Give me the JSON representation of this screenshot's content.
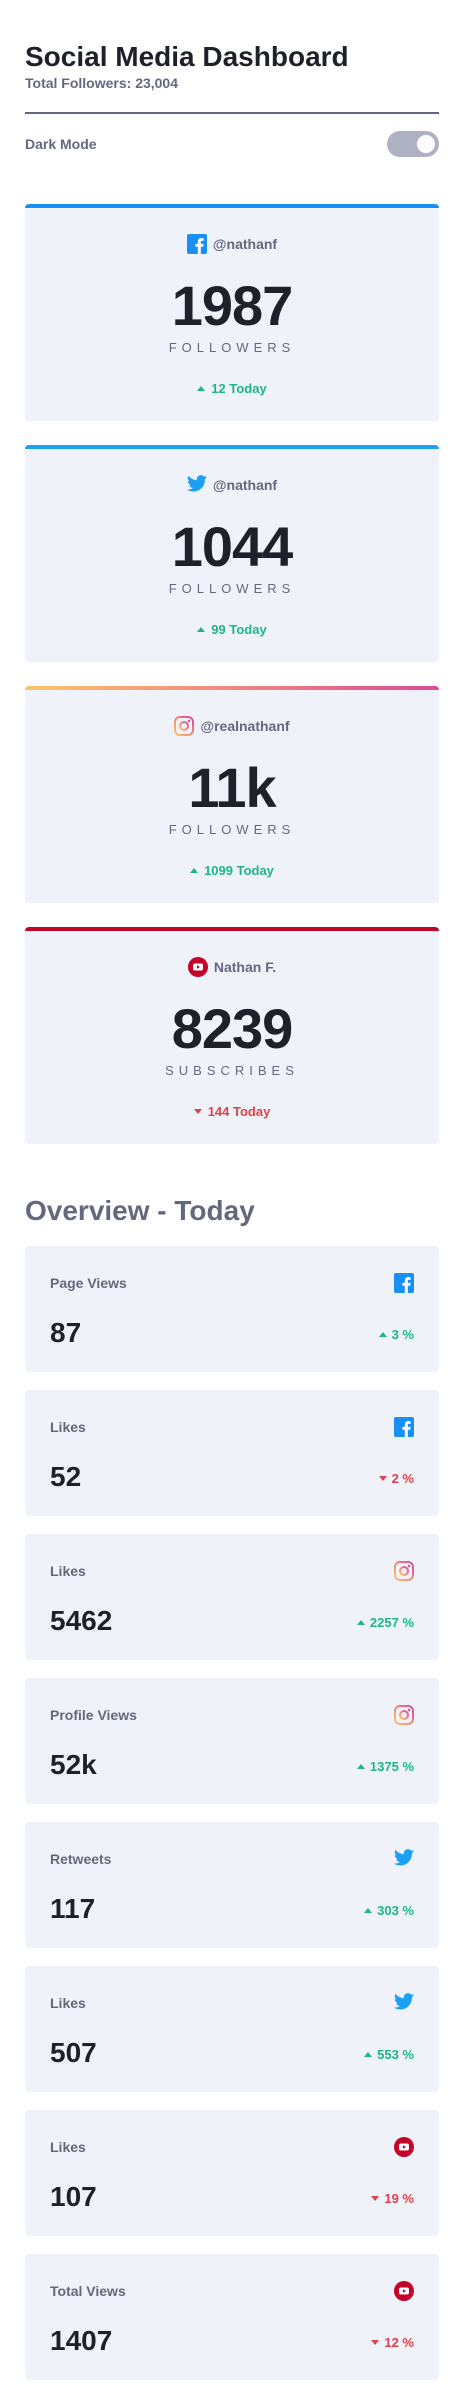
{
  "header": {
    "title": "Social Media Dashboard",
    "total_followers": "Total Followers: 23,004"
  },
  "dark_mode": {
    "label": "Dark Mode",
    "enabled": false
  },
  "colors": {
    "facebook": "#198ff5",
    "twitter": "#1ca0f2",
    "youtube": "#c4032a",
    "instagram_gradient": [
      "#fdc468",
      "#df4996"
    ],
    "up": "#1eb589",
    "down": "#dc414c"
  },
  "cards": [
    {
      "platform": "facebook",
      "icon": "facebook-icon",
      "handle": "@nathanf",
      "count": "1987",
      "label": "FOLLOWERS",
      "today": "12 Today",
      "trend": "up"
    },
    {
      "platform": "twitter",
      "icon": "twitter-icon",
      "handle": "@nathanf",
      "count": "1044",
      "label": "FOLLOWERS",
      "today": "99 Today",
      "trend": "up"
    },
    {
      "platform": "instagram",
      "icon": "instagram-icon",
      "handle": "@realnathanf",
      "count": "11k",
      "label": "FOLLOWERS",
      "today": "1099 Today",
      "trend": "up"
    },
    {
      "platform": "youtube",
      "icon": "youtube-icon",
      "handle": "Nathan F.",
      "count": "8239",
      "label": "SUBSCRIBES",
      "today": "144 Today",
      "trend": "down"
    }
  ],
  "overview": {
    "title": "Overview - Today",
    "items": [
      {
        "label": "Page Views",
        "icon": "facebook-icon",
        "value": "87",
        "change": "3 %",
        "trend": "up"
      },
      {
        "label": "Likes",
        "icon": "facebook-icon",
        "value": "52",
        "change": "2 %",
        "trend": "down"
      },
      {
        "label": "Likes",
        "icon": "instagram-icon",
        "value": "5462",
        "change": "2257 %",
        "trend": "up"
      },
      {
        "label": "Profile Views",
        "icon": "instagram-icon",
        "value": "52k",
        "change": "1375 %",
        "trend": "up"
      },
      {
        "label": "Retweets",
        "icon": "twitter-icon",
        "value": "117",
        "change": "303 %",
        "trend": "up"
      },
      {
        "label": "Likes",
        "icon": "twitter-icon",
        "value": "507",
        "change": "553 %",
        "trend": "up"
      },
      {
        "label": "Likes",
        "icon": "youtube-icon",
        "value": "107",
        "change": "19 %",
        "trend": "down"
      },
      {
        "label": "Total Views",
        "icon": "youtube-icon",
        "value": "1407",
        "change": "12 %",
        "trend": "down"
      }
    ]
  }
}
